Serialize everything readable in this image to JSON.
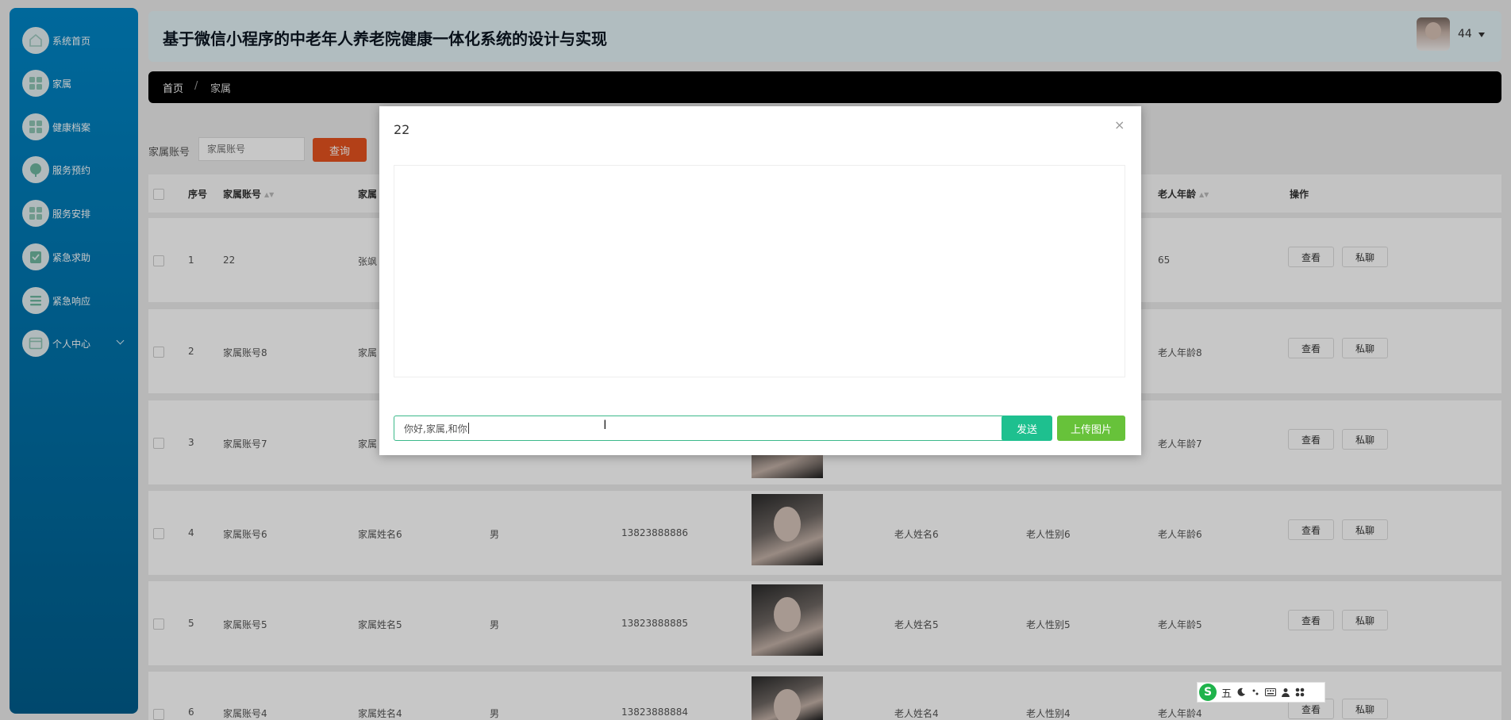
{
  "app": {
    "title": "基于微信小程序的中老年人养老院健康一体化系统的设计与实现"
  },
  "user": {
    "name": "44"
  },
  "sidebar": {
    "items": [
      {
        "label": "系统首页",
        "icon": "home-icon"
      },
      {
        "label": "家属",
        "icon": "grid-icon"
      },
      {
        "label": "健康档案",
        "icon": "grid-icon"
      },
      {
        "label": "服务预约",
        "icon": "leaf-icon"
      },
      {
        "label": "服务安排",
        "icon": "grid-icon"
      },
      {
        "label": "紧急求助",
        "icon": "clipboard-icon"
      },
      {
        "label": "紧急响应",
        "icon": "list-icon"
      },
      {
        "label": "个人中心",
        "icon": "window-icon"
      }
    ]
  },
  "breadcrumb": {
    "home": "首页",
    "separator": "/",
    "current": "家属"
  },
  "search": {
    "label": "家属账号",
    "placeholder": "家属账号",
    "button": "查询"
  },
  "table": {
    "columns": {
      "index": "序号",
      "account": "家属账号",
      "name": "家属",
      "elder_age": "老人年龄",
      "actions": "操作"
    },
    "rows": [
      {
        "index": "1",
        "account": "22",
        "name": "张飒",
        "gender": "",
        "phone": "",
        "elder_name": "",
        "elder_gender": "",
        "elder_age": "65"
      },
      {
        "index": "2",
        "account": "家属账号8",
        "name": "家属",
        "gender": "",
        "phone": "",
        "elder_name": "",
        "elder_gender": "",
        "elder_age": "老人年龄8"
      },
      {
        "index": "3",
        "account": "家属账号7",
        "name": "家属",
        "gender": "",
        "phone": "",
        "elder_name": "",
        "elder_gender": "",
        "elder_age": "老人年龄7"
      },
      {
        "index": "4",
        "account": "家属账号6",
        "name": "家属姓名6",
        "gender": "男",
        "phone": "13823888886",
        "elder_name": "老人姓名6",
        "elder_gender": "老人性别6",
        "elder_age": "老人年龄6"
      },
      {
        "index": "5",
        "account": "家属账号5",
        "name": "家属姓名5",
        "gender": "男",
        "phone": "13823888885",
        "elder_name": "老人姓名5",
        "elder_gender": "老人性别5",
        "elder_age": "老人年龄5"
      },
      {
        "index": "6",
        "account": "家属账号4",
        "name": "家属姓名4",
        "gender": "男",
        "phone": "13823888884",
        "elder_name": "老人姓名4",
        "elder_gender": "老人性别4",
        "elder_age": "老人年龄4"
      }
    ],
    "view_label": "查看",
    "chat_label": "私聊"
  },
  "dialog": {
    "title": "22",
    "close": "×",
    "input_value": "你好,家属,和你",
    "send_label": "发送",
    "upload_label": "上传图片"
  },
  "ime": {
    "logo": "S",
    "mode": "五"
  },
  "colors": {
    "sidebar": "#0079b4",
    "header": "#e3f2f7",
    "search_button": "#e6531f",
    "send_button": "#1ec08f",
    "upload_button": "#67c23a",
    "breadcrumb_bar": "#000000"
  }
}
